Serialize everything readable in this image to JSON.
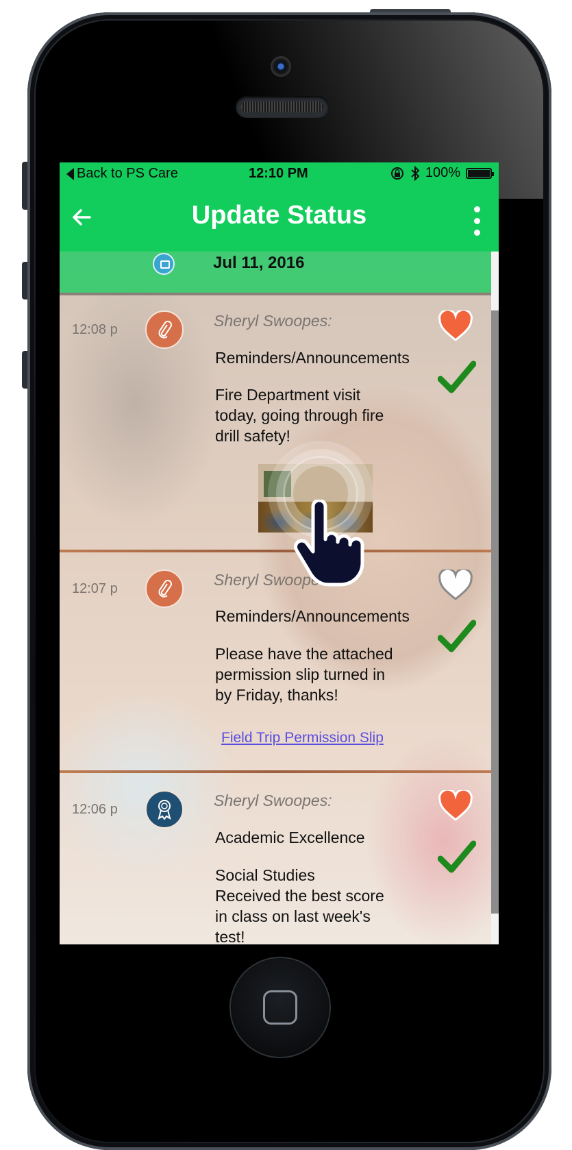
{
  "status_bar": {
    "back_label": "Back to PS Care",
    "time": "12:10 PM",
    "battery": "100%"
  },
  "app_bar": {
    "title": "Update Status",
    "back_icon": "arrow-left-icon",
    "menu_icon": "more-vertical-icon",
    "color": "#12cc5c"
  },
  "date_header": {
    "date": "Jul 11, 2016",
    "icon": "calendar-icon"
  },
  "feed": [
    {
      "time": "12:08 p",
      "icon": "paperclip-icon",
      "icon_color": "#d6704a",
      "author": "Sheryl Swoopes:",
      "category": "Reminders/Announcements",
      "message": "Fire Department visit\ntoday, going through fire\ndrill safety!",
      "liked": true,
      "attachment": "photo",
      "acknowledged": true
    },
    {
      "time": "12:07 p",
      "icon": "paperclip-icon",
      "icon_color": "#d6704a",
      "author": "Sheryl Swoopes:",
      "category": "Reminders/Announcements",
      "message": "Please have the attached\npermission slip turned in\nby Friday, thanks!",
      "liked": false,
      "attachment_link": "Field Trip Permission Slip",
      "acknowledged": true
    },
    {
      "time": "12:06 p",
      "icon": "award-ribbon-icon",
      "icon_color": "#1f4f72",
      "author": "Sheryl Swoopes:",
      "category": "Academic Excellence",
      "message": "Social Studies\nReceived the best score\nin class on last week's\ntest!",
      "liked": true,
      "acknowledged": true
    }
  ],
  "colors": {
    "heart_liked": "#f2643b",
    "check": "#1e8a1e",
    "link": "#5b4de0"
  }
}
